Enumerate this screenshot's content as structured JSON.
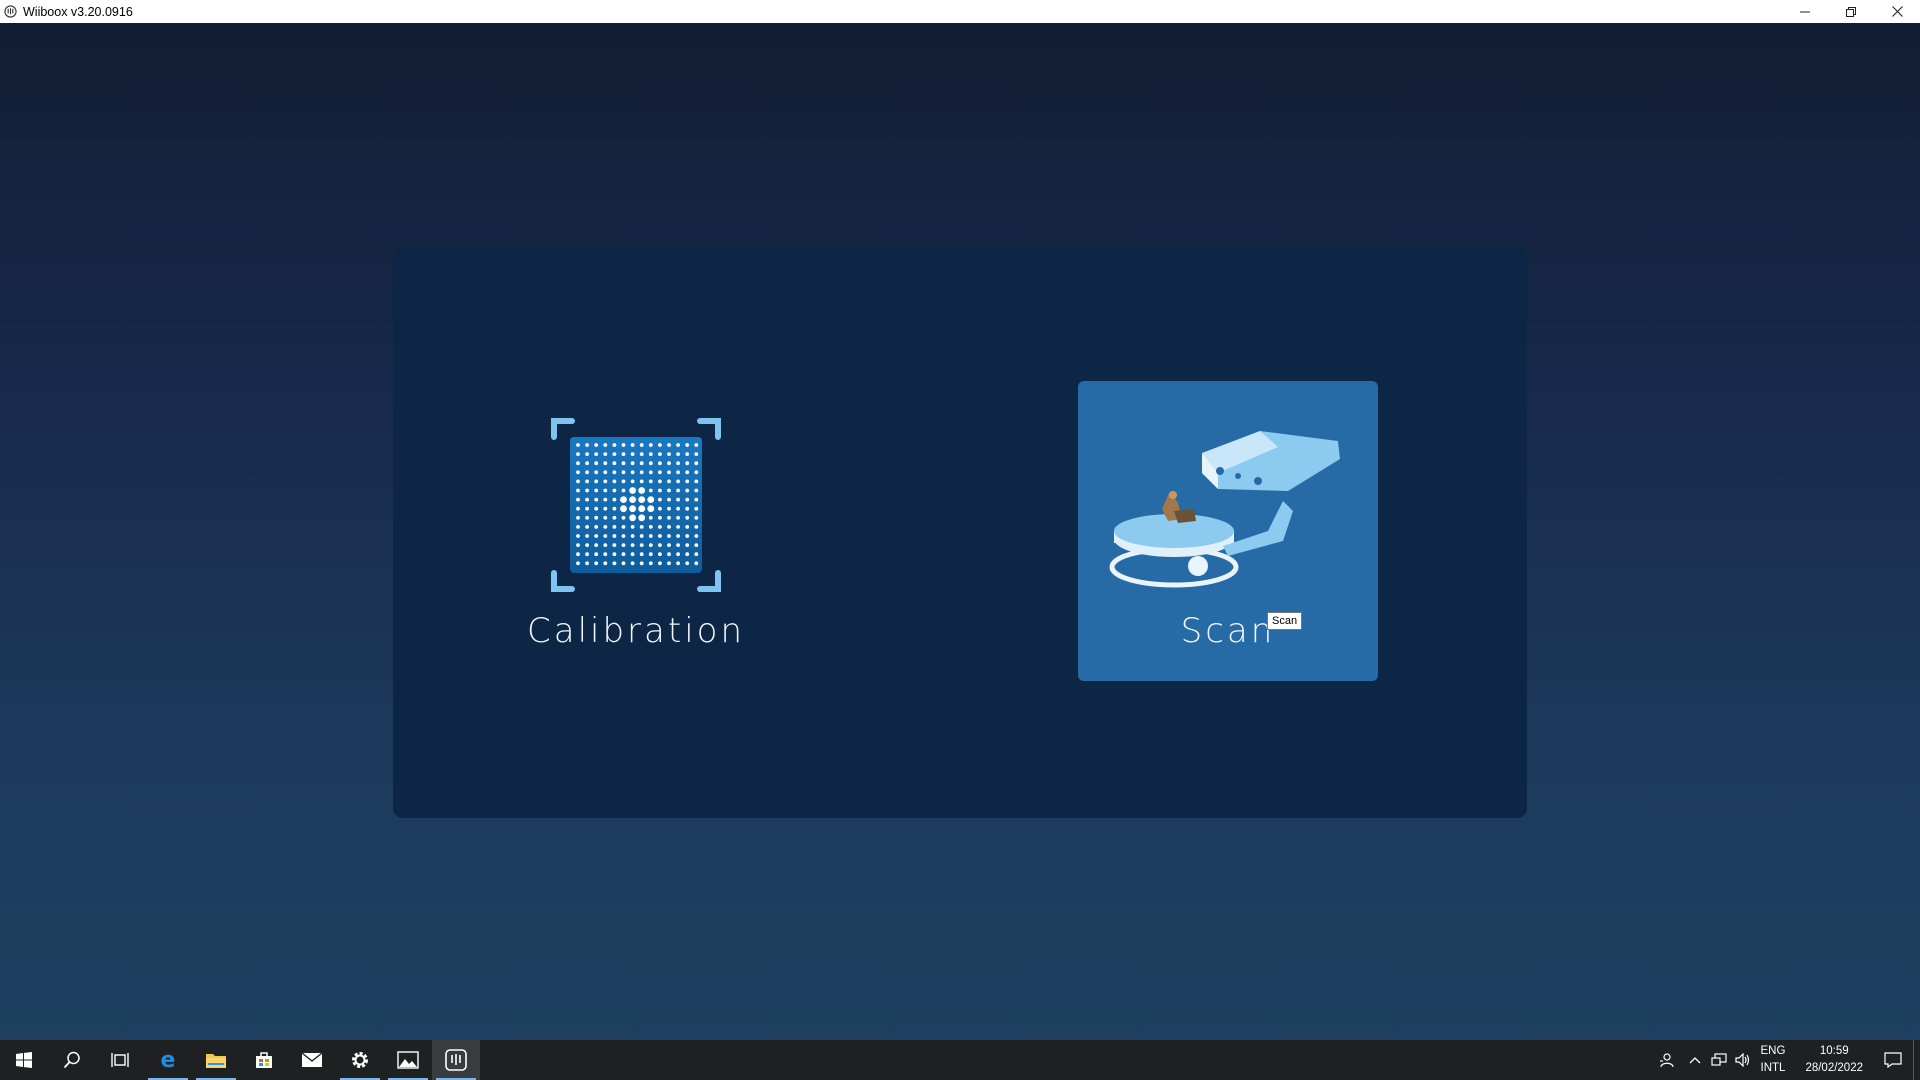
{
  "window": {
    "title": "Wiiboox v3.20.0916",
    "minimize_icon": "minimize-icon",
    "restore_icon": "restore-icon",
    "close_icon": "close-icon"
  },
  "main": {
    "calibration_label": "Calibration",
    "scan_label": "Scan",
    "scan_tooltip": "Scan"
  },
  "colors": {
    "panel": "#0d2645",
    "scan_tile": "#276ba6",
    "accent": "#7ab4e8"
  },
  "taskbar": {
    "items": [
      "start",
      "search",
      "task-view",
      "edge",
      "file-explorer",
      "store",
      "mail",
      "settings",
      "photos",
      "wiiboox"
    ],
    "lang_line1": "ENG",
    "lang_line2": "INTL",
    "time": "10:59",
    "date": "28/02/2022"
  }
}
